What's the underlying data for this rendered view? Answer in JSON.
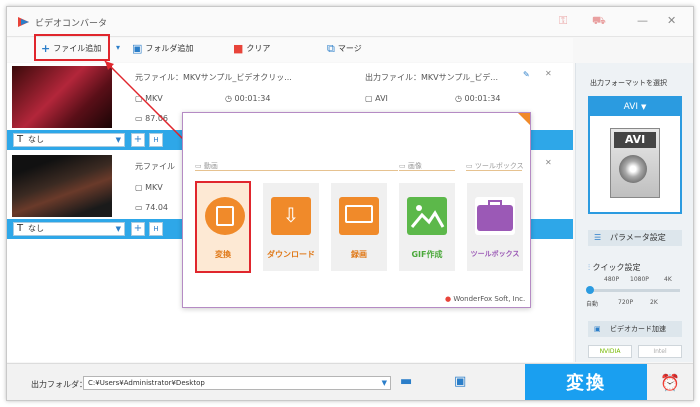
{
  "app": {
    "title": "ビデオコンバータ"
  },
  "toolbar": {
    "add_file": "ファイル追加",
    "add_folder": "フォルダ追加",
    "clear": "クリア",
    "merge": "マージ"
  },
  "files": [
    {
      "source_label": "元ファイル：MKVサンプル_ビデオクリッ...",
      "source_format": "MKV",
      "source_duration": "00:01:34",
      "source_size": "87.06",
      "output_label": "出力ファイル：MKVサンプル_ビデ...",
      "output_format": "AVI",
      "output_duration": "00:01:34",
      "subtitle": "なし"
    },
    {
      "source_label": "元ファイル",
      "source_format": "MKV",
      "source_size": "74.04",
      "subtitle": "なし"
    }
  ],
  "right_panel": {
    "format_heading": "出力フォーマットを選択",
    "selected_format": "AVI",
    "format_icon_text": "AVI",
    "param_button": "パラメータ設定",
    "quick_heading": "クイック設定",
    "quality_top": [
      "480P",
      "1080P",
      "4K"
    ],
    "quality_bottom": [
      "自動",
      "720P",
      "2K"
    ],
    "gpu_heading": "ビデオカード加速",
    "gpu_vendors": [
      "NVIDIA",
      "Intel"
    ]
  },
  "modal": {
    "section_video": "動画",
    "section_image": "画像",
    "section_tools": "ツールボックス",
    "tiles": [
      "変換",
      "ダウンロード",
      "録画",
      "GIF作成",
      "ツールボックス"
    ],
    "brand": "WonderFox Soft, Inc."
  },
  "bottom": {
    "folder_label": "出力フォルダ：",
    "folder_path": "C:¥Users¥Administrator¥Desktop",
    "convert": "変換"
  },
  "colors": {
    "accent": "#1a9ff0",
    "highlight": "#e0262d",
    "tile_orange": "#f08a2a",
    "tile_green": "#5cb84a",
    "tile_purple": "#9b59b6"
  }
}
